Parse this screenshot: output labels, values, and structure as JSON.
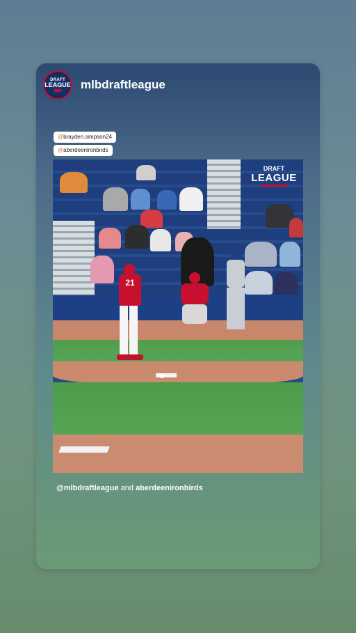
{
  "story": {
    "username": "mlbdraftleague",
    "avatar_text_top": "DRAFT",
    "avatar_text_main": "LEAGUE",
    "mentions": [
      "brayden.simpson24",
      "aberdeenironbirds"
    ],
    "video_logo_top": "DRAFT",
    "video_logo_main": "LEAGUE",
    "caption_user1": "@mlbdraftleague",
    "caption_and": "and",
    "caption_user2": "aberdeenironbirds",
    "pitcher_number": "21"
  },
  "colors": {
    "accent_red": "#c7102e",
    "mention_at": "#e27a2e"
  }
}
